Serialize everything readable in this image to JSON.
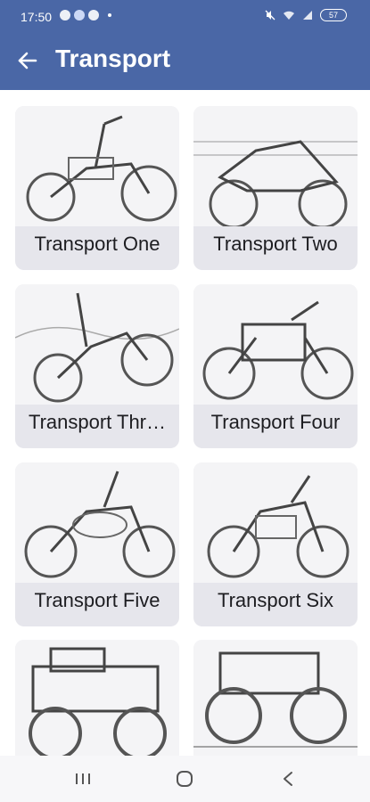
{
  "status_bar": {
    "time": "17:50",
    "battery": "57",
    "icons": [
      "notification-icon",
      "cat-app-icon",
      "dnd-icon",
      "mute-icon",
      "wifi-icon",
      "signal-icon",
      "battery-icon"
    ]
  },
  "header": {
    "title": "Transport",
    "back_icon": "arrow-left-icon",
    "background": "#4a67a6"
  },
  "cards": [
    {
      "label": "Transport One",
      "image": "motorcycle-sketch"
    },
    {
      "label": "Transport Two",
      "image": "sport-bike-sketch"
    },
    {
      "label": "Transport Thr…",
      "image": "dirt-bike-sketch"
    },
    {
      "label": "Transport Four",
      "image": "classic-motorcycle-sketch"
    },
    {
      "label": "Transport Five",
      "image": "cruiser-sketch"
    },
    {
      "label": "Transport Six",
      "image": "scrambler-sketch"
    },
    {
      "label": "",
      "image": "monster-truck-sketch"
    },
    {
      "label": "",
      "image": "monster-truck-sketch"
    }
  ],
  "nav": {
    "recents": "recents-icon",
    "home": "home-icon",
    "back": "back-icon"
  }
}
